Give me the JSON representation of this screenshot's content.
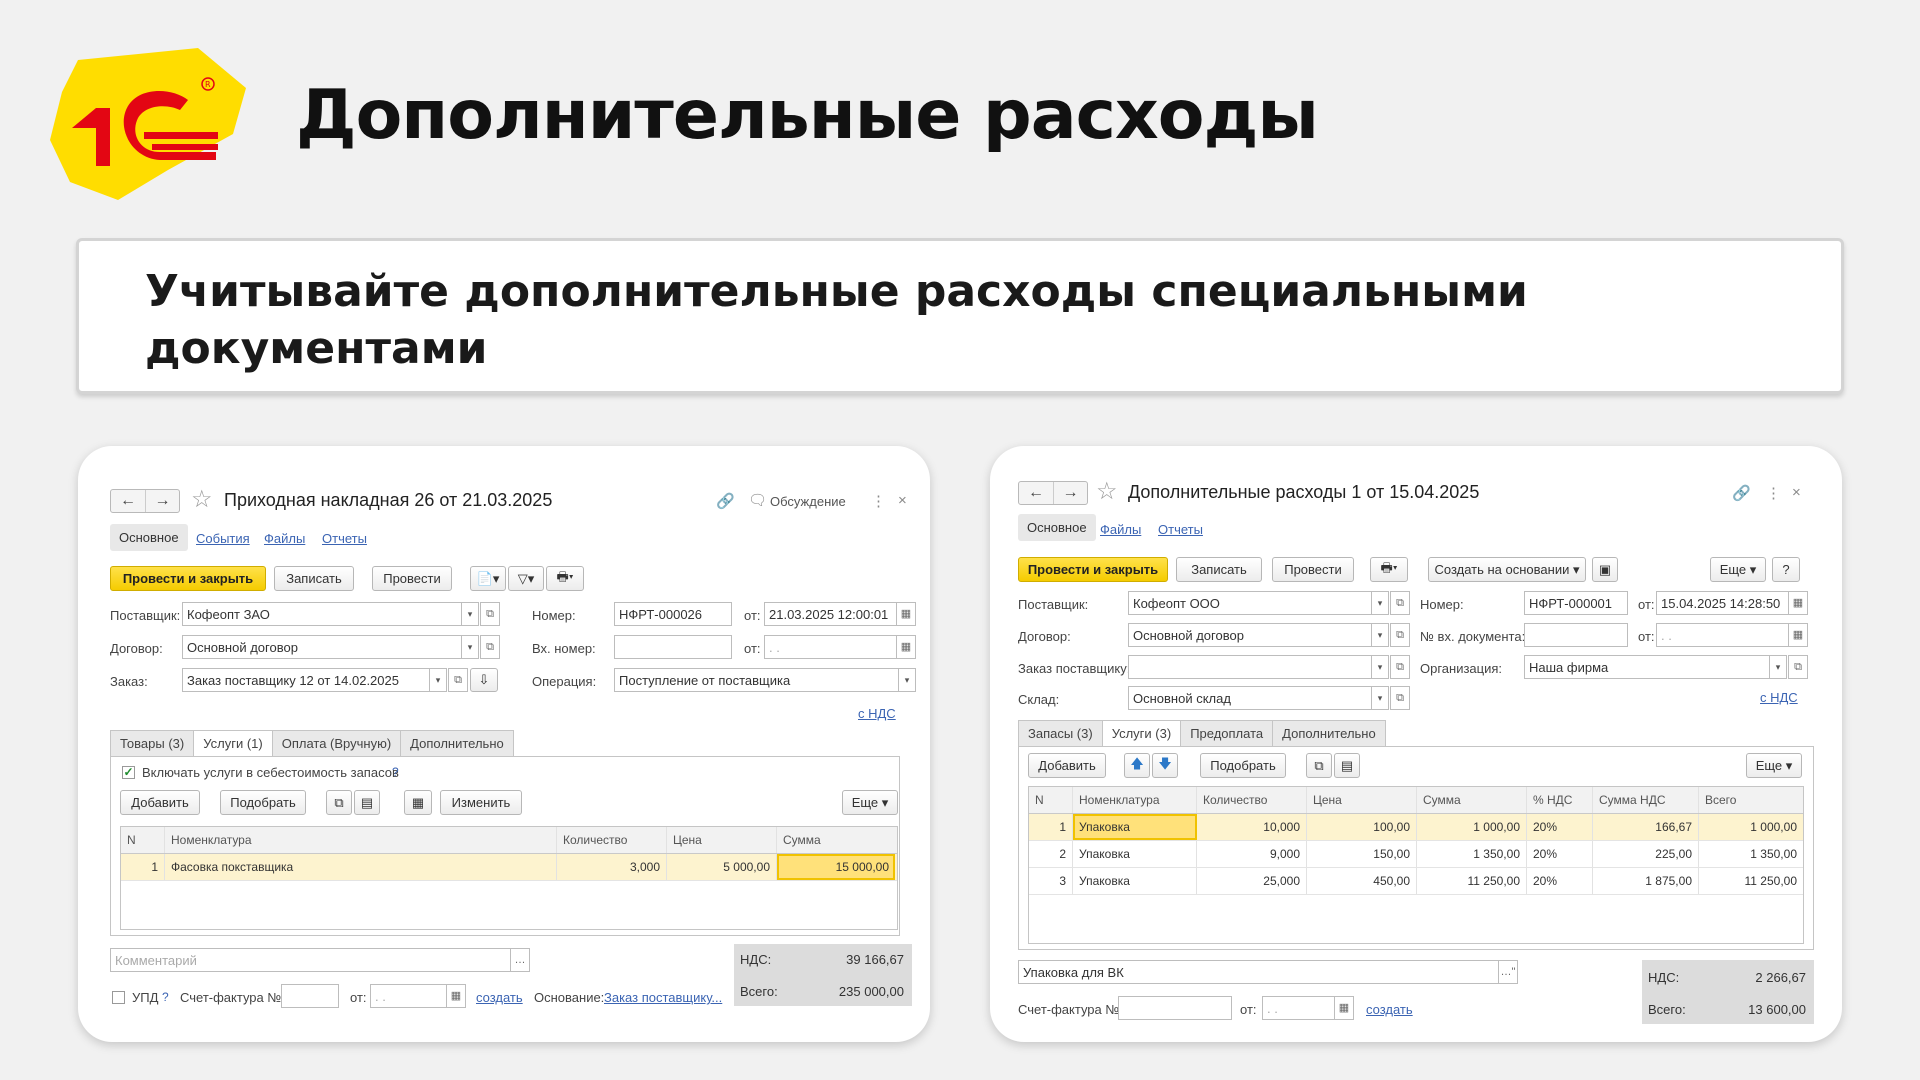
{
  "slide": {
    "title": "Дополнительные расходы",
    "banner": "Учитывайте дополнительные расходы специальными документами",
    "logo_text": "1С",
    "brand_colors": {
      "red": "#e30613",
      "yellow": "#ffdd00"
    }
  },
  "left": {
    "nav_back": "←",
    "nav_fwd": "→",
    "title": "Приходная накладная 26 от 21.03.2025",
    "discussion": "Обсуждение",
    "tabs": [
      "Основное",
      "События",
      "Файлы",
      "Отчеты"
    ],
    "toolbar": {
      "post_close": "Провести и закрыть",
      "save": "Записать",
      "post": "Провести"
    },
    "labels": {
      "supplier": "Поставщик:",
      "contract": "Договор:",
      "order": "Заказ:",
      "number": "Номер:",
      "in_number": "Вх. номер:",
      "operation": "Операция:",
      "from1": "от:",
      "from2": "от:"
    },
    "fields": {
      "supplier": "Кофеопт ЗАО",
      "contract": "Основной договор",
      "order": "Заказ поставщику 12 от 14.02.2025",
      "number": "НФРТ-000026",
      "date": "21.03.2025 12:00:01",
      "in_number": "",
      "in_date": " .  .",
      "operation": "Поступление от поставщика"
    },
    "vat_link": "с НДС",
    "subtabs": [
      "Товары (3)",
      "Услуги (1)",
      "Оплата (Вручную)",
      "Дополнительно"
    ],
    "include_services": "Включать услуги в себестоимость запасов",
    "help": "?",
    "grid_buttons": {
      "add": "Добавить",
      "pick": "Подобрать",
      "change": "Изменить",
      "more": "Еще"
    },
    "columns": [
      "N",
      "Номенклатура",
      "Количество",
      "Цена",
      "Сумма"
    ],
    "rows": [
      {
        "n": "1",
        "name": "Фасовка покставщика",
        "qty": "3,000",
        "price": "5 000,00",
        "sum": "15 000,00"
      }
    ],
    "comment_placeholder": "Комментарий",
    "vat_label": "НДС:",
    "vat_value": "39 166,67",
    "total_label": "Всего:",
    "total_value": "235 000,00",
    "upd": "УПД",
    "invoice_label": "Счет-фактура №:",
    "invoice_from": "от:",
    "invoice_date": " .  .",
    "create": "создать",
    "basis_label": "Основание:",
    "basis_link": "Заказ поставщику..."
  },
  "right": {
    "nav_back": "←",
    "nav_fwd": "→",
    "title": "Дополнительные расходы 1 от 15.04.2025",
    "tabs": [
      "Основное",
      "Файлы",
      "Отчеты"
    ],
    "toolbar": {
      "post_close": "Провести и закрыть",
      "save": "Записать",
      "post": "Провести",
      "create_based": "Создать на основании",
      "more": "Еще",
      "help": "?"
    },
    "labels": {
      "supplier": "Поставщик:",
      "contract": "Договор:",
      "order": "Заказ поставщику:",
      "warehouse": "Склад:",
      "number": "Номер:",
      "in_doc": "№ вх. документа:",
      "org": "Организация:",
      "from1": "от:",
      "from2": "от:"
    },
    "fields": {
      "supplier": "Кофеопт ООО",
      "contract": "Основной договор",
      "order": "",
      "warehouse": "Основной склад",
      "number": "НФРТ-000001",
      "date": "15.04.2025 14:28:50",
      "in_doc": "",
      "in_date": " .  .",
      "org": "Наша фирма"
    },
    "vat_link": "с НДС",
    "subtabs": [
      "Запасы (3)",
      "Услуги (3)",
      "Предоплата",
      "Дополнительно"
    ],
    "grid_buttons": {
      "add": "Добавить",
      "pick": "Подобрать",
      "more": "Еще"
    },
    "columns": [
      "N",
      "Номенклатура",
      "Количество",
      "Цена",
      "Сумма",
      "% НДС",
      "Сумма НДС",
      "Всего"
    ],
    "rows": [
      {
        "n": "1",
        "name": "Упаковка",
        "qty": "10,000",
        "price": "100,00",
        "sum": "1 000,00",
        "vat_rate": "20%",
        "vat_sum": "166,67",
        "total": "1 000,00"
      },
      {
        "n": "2",
        "name": "Упаковка",
        "qty": "9,000",
        "price": "150,00",
        "sum": "1 350,00",
        "vat_rate": "20%",
        "vat_sum": "225,00",
        "total": "1 350,00"
      },
      {
        "n": "3",
        "name": "Упаковка",
        "qty": "25,000",
        "price": "450,00",
        "sum": "11 250,00",
        "vat_rate": "20%",
        "vat_sum": "1 875,00",
        "total": "11 250,00"
      }
    ],
    "comment": "Упаковка для ВК",
    "vat_label": "НДС:",
    "vat_value": "2 266,67",
    "total_label": "Всего:",
    "total_value": "13 600,00",
    "invoice_label": "Счет-фактура №:",
    "invoice_from": "от:",
    "invoice_date": " .  .",
    "create": "создать"
  }
}
